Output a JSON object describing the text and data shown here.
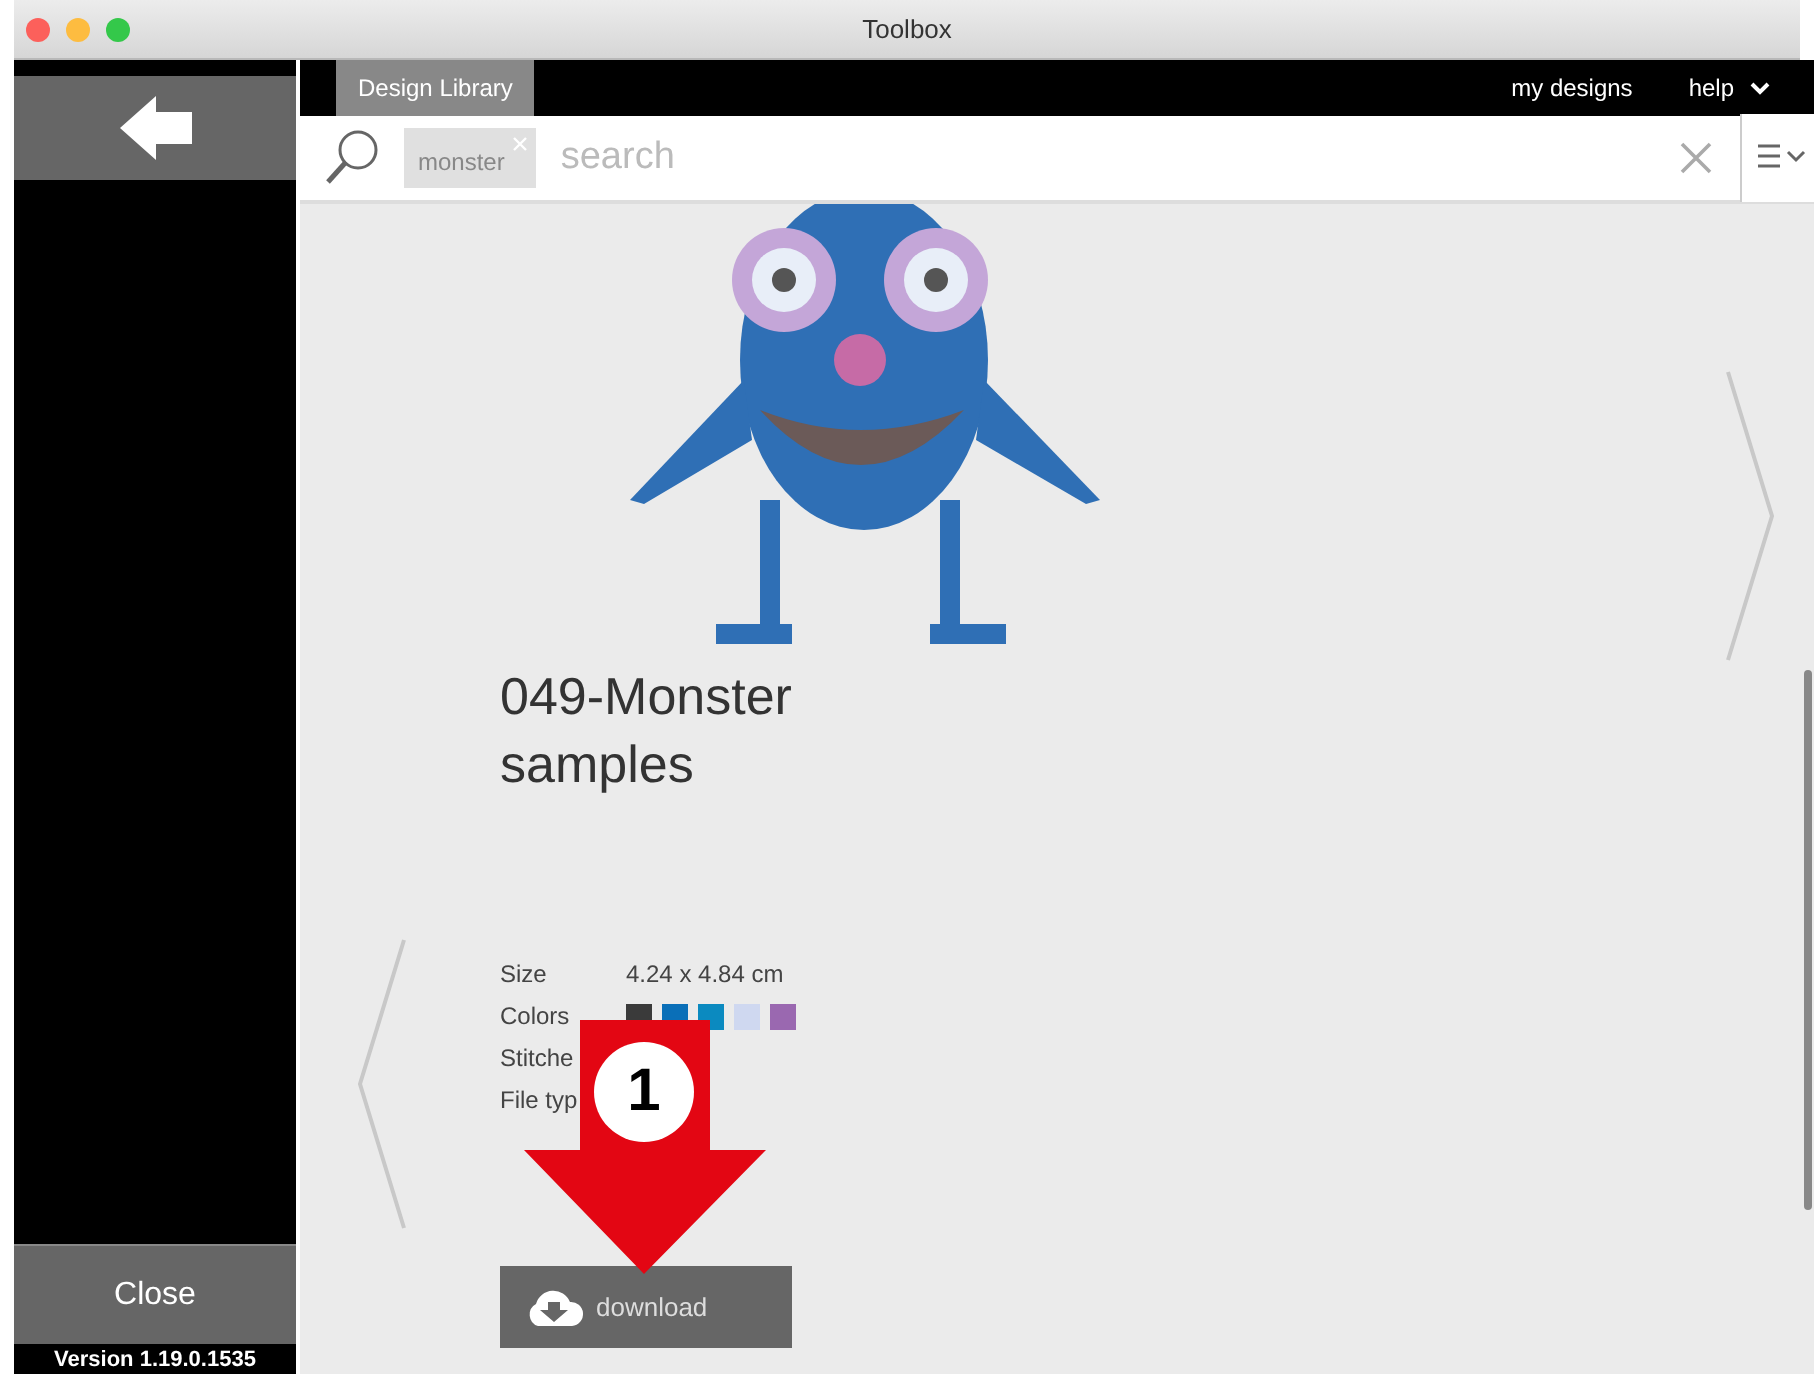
{
  "window": {
    "title": "Toolbox"
  },
  "sidebar": {
    "close_button": "Close",
    "version": "Version 1.19.0.1535"
  },
  "nav": {
    "tabs": [
      {
        "label": "Design Library",
        "selected": true
      }
    ],
    "links": [
      "my designs",
      "help"
    ]
  },
  "search": {
    "tags": [
      "monster"
    ],
    "placeholder": "search"
  },
  "design": {
    "title": "049-Monster samples",
    "details": [
      {
        "kind": "text",
        "label": "Size",
        "value": "4.24 x 4.84 cm"
      },
      {
        "kind": "swatches",
        "label": "Colors",
        "colors": [
          {
            "color": "#3a3a3a"
          },
          {
            "color": "#0a6fb8"
          },
          {
            "color": "#0b8ac0"
          },
          {
            "color": "#cfd8f0"
          },
          {
            "color": "#9a68b0"
          }
        ]
      },
      {
        "kind": "text",
        "label": "Stitche"
      },
      {
        "kind": "text",
        "label": "File typ"
      }
    ],
    "download_button": "download"
  },
  "annotation": {
    "number": "1"
  }
}
